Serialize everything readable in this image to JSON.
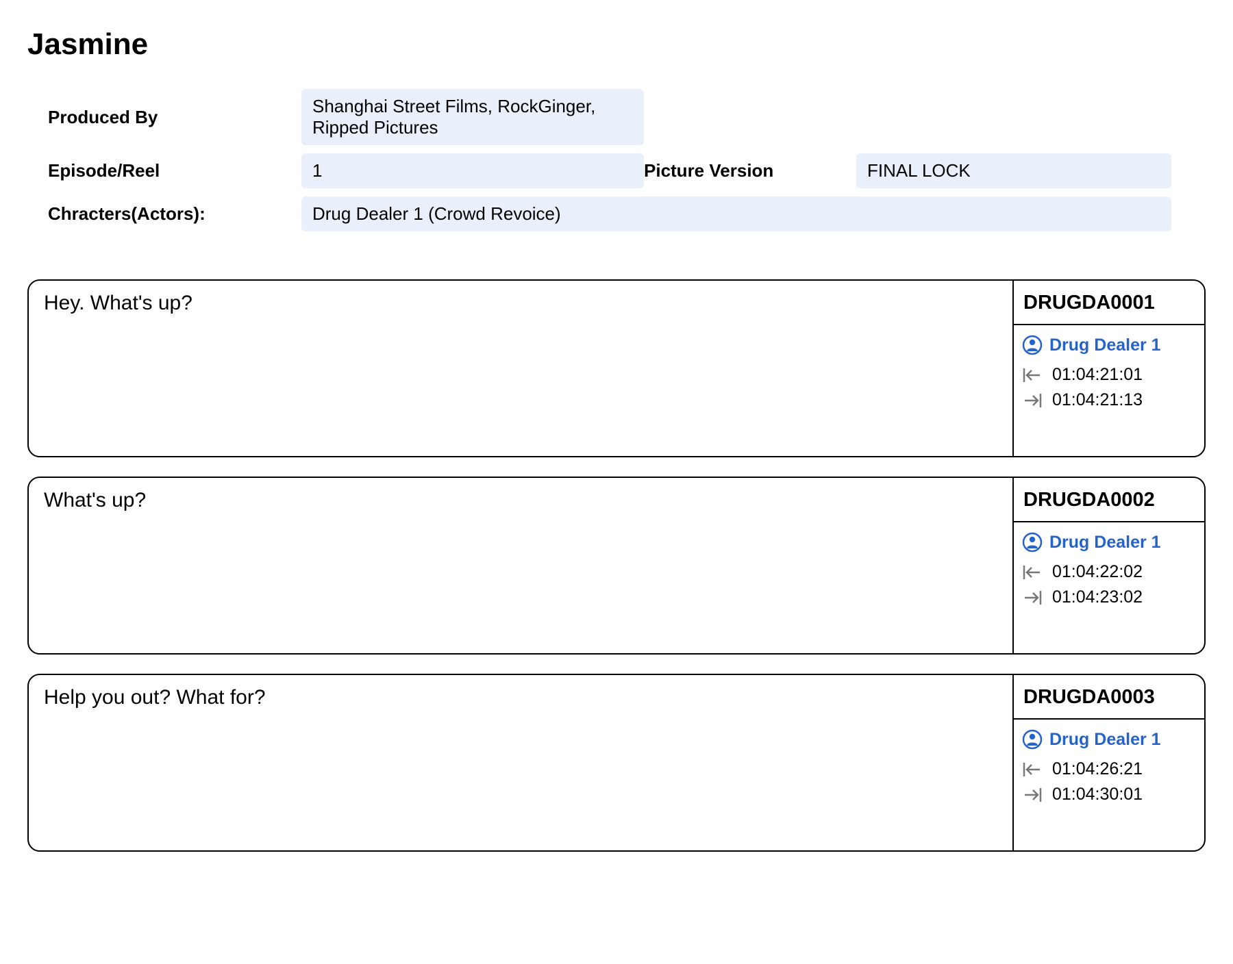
{
  "title": "Jasmine",
  "meta": {
    "produced_by_label": "Produced By",
    "produced_by_value": "Shanghai Street Films, RockGinger, Ripped Pictures",
    "episode_label": "Episode/Reel",
    "episode_value": "1",
    "picture_version_label": "Picture Version",
    "picture_version_value": "FINAL LOCK",
    "characters_label": "Chracters(Actors):",
    "characters_value": "Drug Dealer 1 (Crowd Revoice)"
  },
  "colors": {
    "accent": "#2563c9",
    "field_bg": "#e9f0fb"
  },
  "cues": [
    {
      "dialogue": "Hey. What's up?",
      "id": "DRUGDA0001",
      "character": "Drug Dealer 1",
      "tc_in": "01:04:21:01",
      "tc_out": "01:04:21:13"
    },
    {
      "dialogue": "What's up?",
      "id": "DRUGDA0002",
      "character": "Drug Dealer 1",
      "tc_in": "01:04:22:02",
      "tc_out": "01:04:23:02"
    },
    {
      "dialogue": "Help you out? What for?",
      "id": "DRUGDA0003",
      "character": "Drug Dealer 1",
      "tc_in": "01:04:26:21",
      "tc_out": "01:04:30:01"
    }
  ]
}
